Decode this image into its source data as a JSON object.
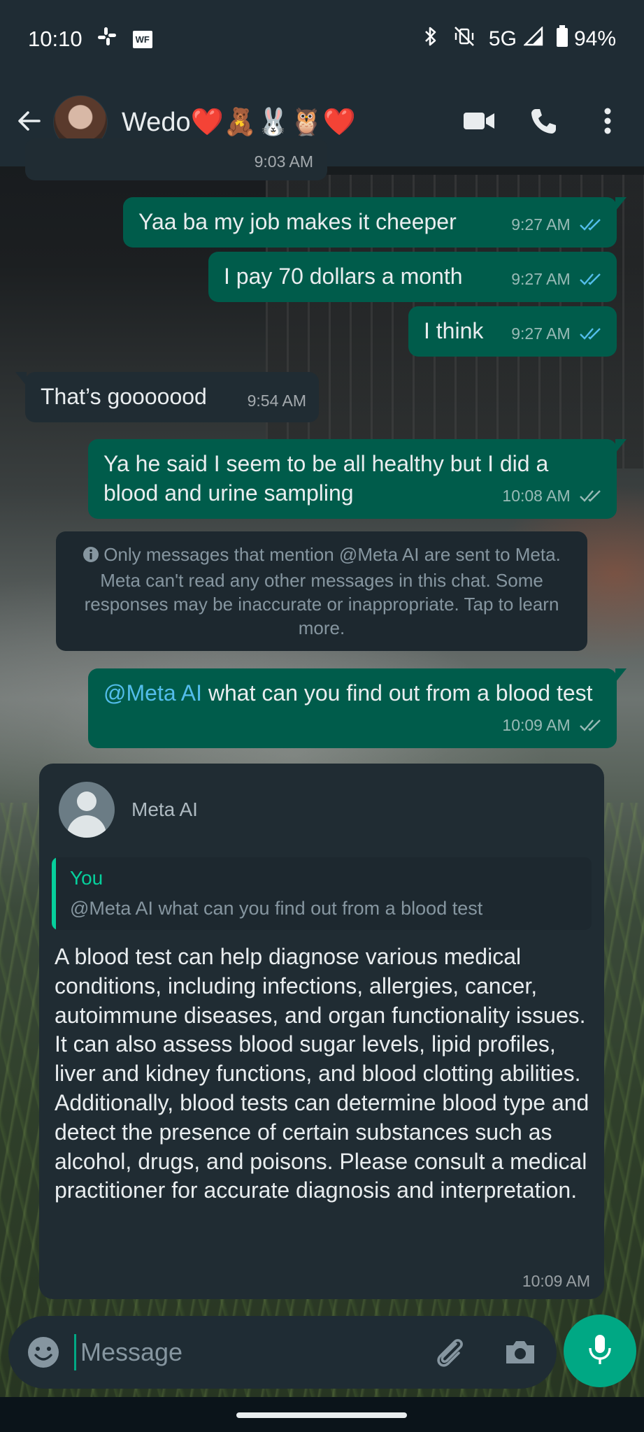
{
  "status_bar": {
    "time": "10:10",
    "work_badge": "WF",
    "network": "5G",
    "battery": "94%"
  },
  "header": {
    "contact_name": "Wedo❤️🧸🐰🦉❤️"
  },
  "messages": [
    {
      "direction": "incoming",
      "text": "",
      "time": "9:03 AM"
    },
    {
      "direction": "outgoing",
      "text": "Yaa ba my job makes it cheeper",
      "time": "9:27 AM",
      "status": "read"
    },
    {
      "direction": "outgoing",
      "text": "I pay 70 dollars a month",
      "time": "9:27 AM",
      "status": "read"
    },
    {
      "direction": "outgoing",
      "text": "I think",
      "time": "9:27 AM",
      "status": "read"
    },
    {
      "direction": "incoming",
      "text": "That’s gooooood",
      "time": "9:54 AM"
    },
    {
      "direction": "outgoing",
      "text": "Ya he said I seem to be all healthy but I did a blood and urine sampling",
      "time": "10:08 AM",
      "status": "delivered"
    },
    {
      "direction": "outgoing",
      "mention": "@Meta AI",
      "text": " what can you find out from a blood test",
      "time": "10:09 AM",
      "status": "delivered"
    }
  ],
  "system_notice": {
    "text": "Only messages that mention @Meta AI are sent to Meta. Meta can't read any other messages in this chat. Some responses may be inaccurate or inappropriate. Tap to learn more."
  },
  "meta_ai_reply": {
    "sender": "Meta AI",
    "quote_author": "You",
    "quote_text": "@Meta AI what can you find out from a blood test",
    "text": "A blood test can help diagnose various medical conditions, including infections, allergies, cancer, autoimmune diseases, and organ functionality issues. It can also assess blood sugar levels, lipid profiles, liver and kidney functions, and blood clotting abilities. Additionally, blood tests can determine blood type and detect the presence of certain substances such as alcohol, drugs, and poisons. Please consult a medical practitioner for accurate diagnosis and interpretation.",
    "time": "10:09 AM"
  },
  "composer": {
    "placeholder": "Message"
  },
  "icons": {
    "back": "arrow-left-icon",
    "video": "video-call-icon",
    "call": "phone-icon",
    "menu": "more-vertical-icon",
    "emoji": "emoji-icon",
    "attach": "paperclip-icon",
    "camera": "camera-icon",
    "mic": "microphone-icon",
    "read_receipt": "double-check-blue",
    "delivered_receipt": "double-check-gray"
  },
  "colors": {
    "outgoing_bubble": "#005c4b",
    "incoming_bubble": "#202c33",
    "accent": "#00a884",
    "read_tick": "#53bdeb",
    "mention": "#53bdeb"
  }
}
